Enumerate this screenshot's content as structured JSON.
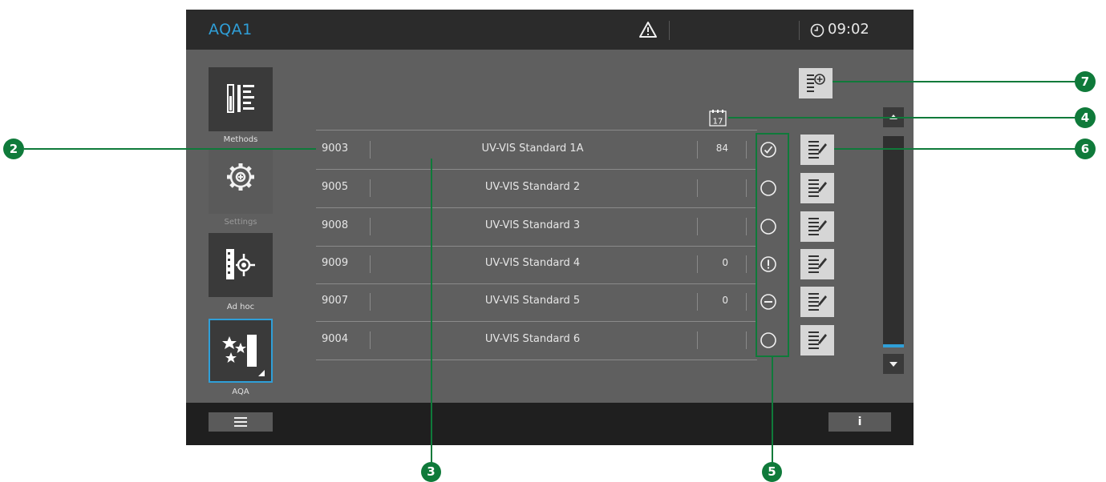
{
  "header": {
    "title": "AQA1",
    "warning_icon": "warning-triangle-icon",
    "clock_icon": "clock-icon",
    "time": "09:02"
  },
  "sidebar": {
    "items": [
      {
        "label": "Methods",
        "icon": "methods-list-icon"
      },
      {
        "label": "Settings",
        "icon": "settings-gear-icon"
      },
      {
        "label": "Ad hoc",
        "icon": "ad-hoc-measure-icon"
      },
      {
        "label": "AQA",
        "icon": "aqa-stars-icon",
        "selected": true
      }
    ]
  },
  "toolbar": {
    "add_button_icon": "add-list-icon",
    "date_column_icon": "calendar-icon",
    "date_column_value": "17"
  },
  "list": {
    "rows": [
      {
        "id": "9003",
        "name": "UV-VIS Standard 1A",
        "count": "84",
        "status": "completed"
      },
      {
        "id": "9005",
        "name": "UV-VIS Standard 2",
        "count": "",
        "status": "pending"
      },
      {
        "id": "9008",
        "name": "UV-VIS Standard 3",
        "count": "",
        "status": "pending"
      },
      {
        "id": "9009",
        "name": "UV-VIS Standard 4",
        "count": "0",
        "status": "warning"
      },
      {
        "id": "9007",
        "name": "UV-VIS Standard 5",
        "count": "0",
        "status": "blocked"
      },
      {
        "id": "9004",
        "name": "UV-VIS Standard 6",
        "count": "",
        "status": "pending"
      }
    ]
  },
  "footer": {
    "menu_icon": "hamburger-menu-icon",
    "info_label": "i"
  },
  "callouts": [
    "2",
    "3",
    "4",
    "5",
    "6",
    "7"
  ],
  "colors": {
    "accent": "#2f9fd8",
    "callout": "#0f7a3a",
    "screen_bg": "#5f5f5f",
    "topbar_bg": "#2b2b2b"
  }
}
